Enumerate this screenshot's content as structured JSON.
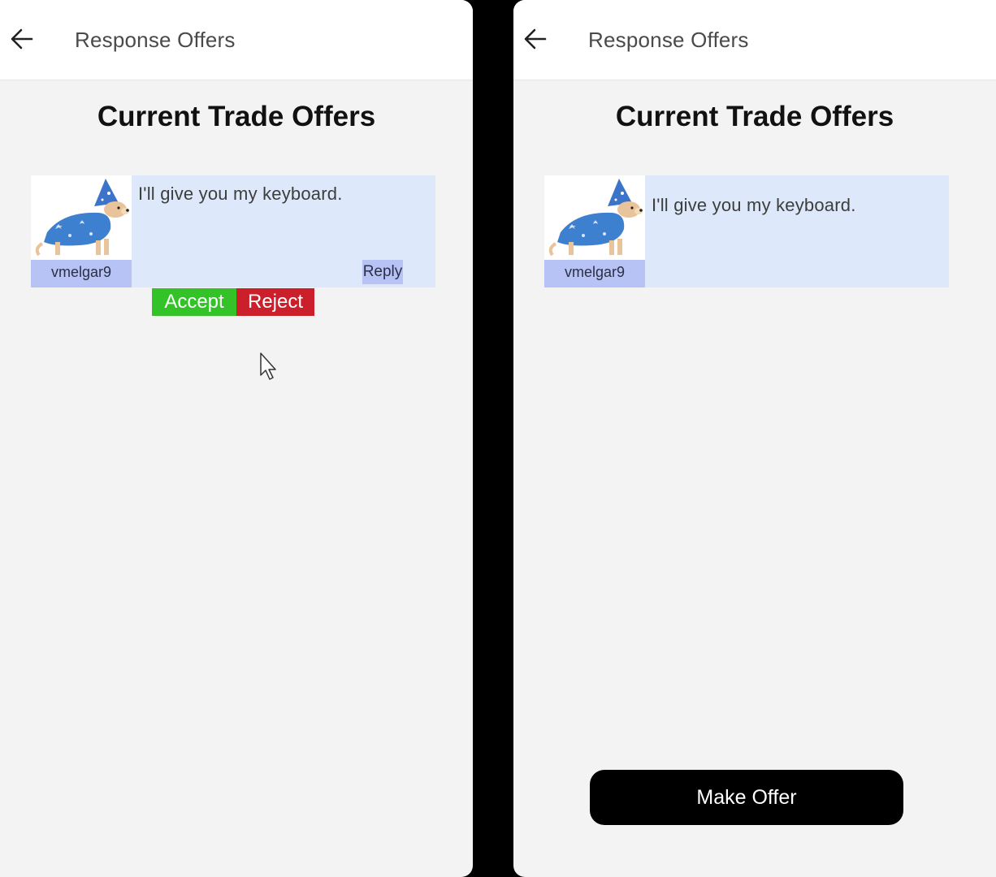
{
  "header": {
    "title": "Response Offers",
    "back_icon": "arrow-left-icon"
  },
  "main": {
    "heading": "Current Trade Offers"
  },
  "offers": [
    {
      "username": "vmelgar9",
      "message": "I'll give you my keyboard.",
      "avatar_icon": "dog-wizard-costume-avatar"
    }
  ],
  "actions": {
    "reply_label": "Reply",
    "accept_label": "Accept",
    "reject_label": "Reject",
    "make_offer_label": "Make Offer"
  },
  "colors": {
    "card_bg": "#dde9fa",
    "username_bg": "#b7c3f4",
    "accept": "#33c329",
    "reject": "#cc1f2c",
    "page_bg": "#f3f3f3"
  }
}
